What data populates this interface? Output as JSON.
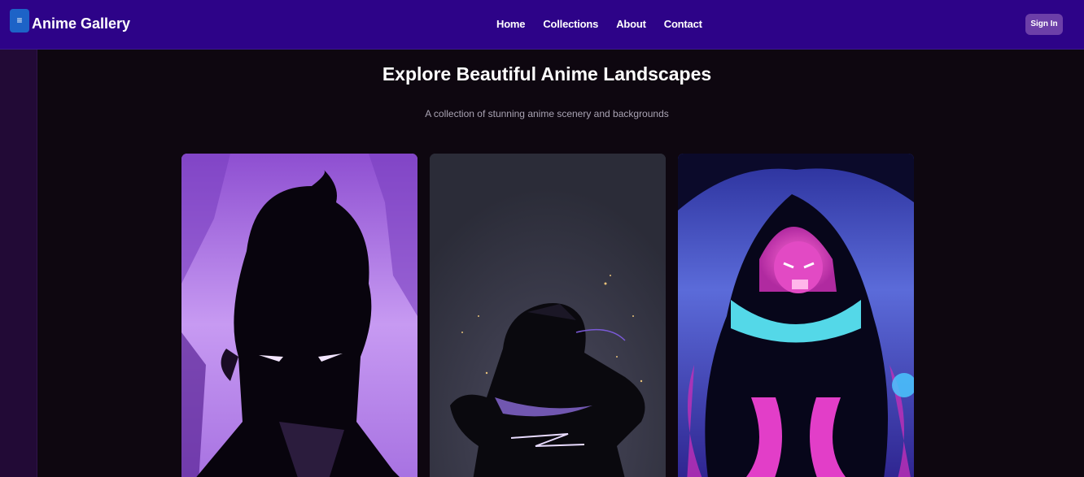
{
  "header": {
    "menu_icon": "≡",
    "brand": "Anime Gallery",
    "nav": [
      "Home",
      "Collections",
      "About",
      "Contact"
    ],
    "signin_label": "Sign In"
  },
  "main": {
    "title": "Explore Beautiful Anime Landscapes",
    "subtitle": "A collection of stunning anime scenery and backgrounds"
  },
  "gallery": [
    {
      "description_icon": "purple-flame-silhouette-image"
    },
    {
      "description_icon": "dark-warrior-lightning-image"
    },
    {
      "description_icon": "shadow-monster-glow-image"
    }
  ],
  "colors": {
    "header_bg": "#2d0388",
    "page_bg": "#0e0710",
    "menu_button": "#1d63c7",
    "signin_button": "#6c3fa8"
  }
}
